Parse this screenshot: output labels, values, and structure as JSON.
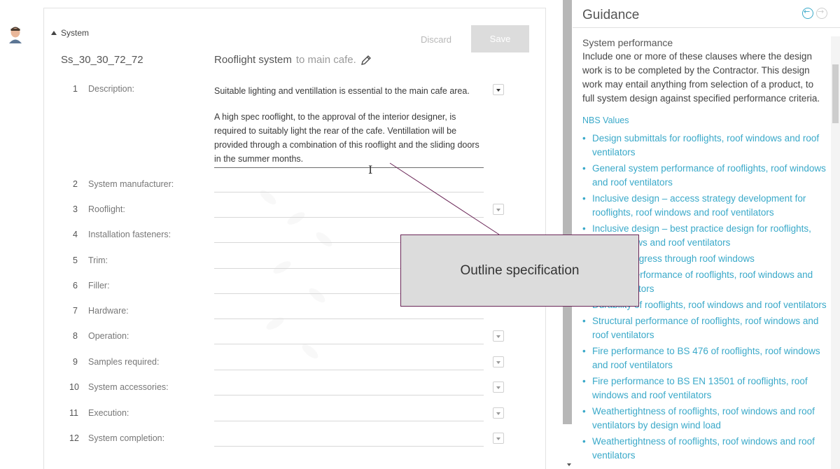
{
  "system": {
    "toggle_label": "System",
    "discard_label": "Discard",
    "save_label": "Save",
    "code": "Ss_30_30_72_72",
    "title": "Rooflight system",
    "subtitle": "to main cafe."
  },
  "description": {
    "number": "1",
    "label": "Description:",
    "paragraph1": "Suitable lighting and ventillation is essential to the main cafe area.",
    "paragraph2": "A high spec rooflight, to the approval of the interior designer, is required to suitably light the rear of the cafe. Ventillation will be provided through a combination of this rooflight and the sliding doors in the summer months."
  },
  "clauses": [
    {
      "number": "2",
      "label": "System manufacturer:"
    },
    {
      "number": "3",
      "label": "Rooflight:"
    },
    {
      "number": "4",
      "label": "Installation fasteners:"
    },
    {
      "number": "5",
      "label": "Trim:"
    },
    {
      "number": "6",
      "label": "Filler:"
    },
    {
      "number": "7",
      "label": "Hardware:"
    },
    {
      "number": "8",
      "label": "Operation:"
    },
    {
      "number": "9",
      "label": "Samples required:",
      "value": "."
    },
    {
      "number": "10",
      "label": "System accessories:"
    },
    {
      "number": "11",
      "label": "Execution:"
    },
    {
      "number": "12",
      "label": "System completion:"
    }
  ],
  "guidance": {
    "title": "Guidance",
    "subtitle": "System performance",
    "paragraph": "Include one or more of these clauses where the design work is to be completed by the Contractor. This design work may entail anything from selection of a product, to full system design against specified performance criteria.",
    "values_heading": "NBS Values",
    "links": [
      "Design submittals for rooflights, roof windows and roof ventilators",
      "General system performance of rooflights, roof windows and roof ventilators",
      "Inclusive design – access strategy development for rooflights, roof windows and roof ventilators",
      "Inclusive design – best practice design for rooflights, roof windows and roof ventilators",
      "Means of egress through roof windows",
      "Thermal performance of rooflights, roof windows and roof ventilators",
      "Durability of rooflights, roof windows and roof ventilators",
      "Structural performance of rooflights, roof windows and roof ventilators",
      "Fire performance to BS 476 of rooflights, roof windows and roof ventilators",
      "Fire performance to BS EN 13501 of rooflights, roof windows and roof ventilators",
      "Weathertightness of rooflights, roof windows and roof ventilators by design wind load",
      "Weathertightness of rooflights, roof windows and roof ventilators"
    ]
  },
  "callout": {
    "text": "Outline specification"
  },
  "colors": {
    "link": "#3aa9c9",
    "callout_border": "#6a2657",
    "callout_bg": "#dcdcdc"
  }
}
